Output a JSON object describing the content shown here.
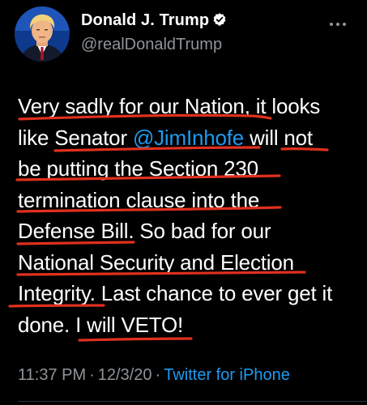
{
  "author": {
    "display_name": "Donald J. Trump",
    "handle": "@realDonaldTrump",
    "verified": true,
    "verified_icon": "verified-badge-icon"
  },
  "tweet": {
    "lines": [
      [
        {
          "t": "Very sadly for our Nation, it looks"
        }
      ],
      [
        {
          "t": "like Senator "
        },
        {
          "t": "@JimInhofe",
          "mention": true
        },
        {
          "t": " will not"
        }
      ],
      [
        {
          "t": "be putting the Section 230"
        }
      ],
      [
        {
          "t": "termination clause into the"
        }
      ],
      [
        {
          "t": "Defense Bill. So bad for our"
        }
      ],
      [
        {
          "t": "National Security and Election"
        }
      ],
      [
        {
          "t": "Integrity. Last chance to ever get it"
        }
      ],
      [
        {
          "t": "done. I will VETO!"
        }
      ]
    ]
  },
  "meta": {
    "time": "11:37 PM",
    "separator": "·",
    "date": "12/3/20",
    "source": "Twitter for iPhone"
  },
  "colors": {
    "background": "#000000",
    "text": "#ffffff",
    "muted": "#8e9499",
    "link": "#1d9bf0",
    "annotation": "#e0301e"
  },
  "icons": {
    "more": "more-options-icon"
  }
}
